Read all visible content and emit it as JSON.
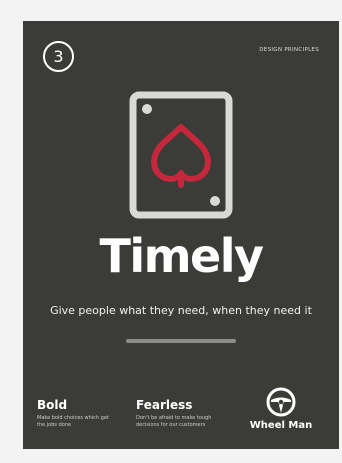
{
  "poster": {
    "number": "3",
    "label": "DESIGN PRINCIPLES",
    "title": "Timely",
    "tagline": "Give people what they need, when they need it",
    "icon": "playing-card-spade-icon",
    "colors": {
      "background": "#3b3b37",
      "card_outline": "#d9d9d6",
      "spade_accent": "#c5283d",
      "divider": "#8d8d89"
    },
    "values": [
      {
        "title": "Bold",
        "desc": "Make bold choices which get the jobs done"
      },
      {
        "title": "Fearless",
        "desc": "Don't be afraid to make tough decisions for our customers"
      }
    ],
    "brand": {
      "name": "Wheel Man",
      "icon": "steering-wheel-icon"
    }
  }
}
